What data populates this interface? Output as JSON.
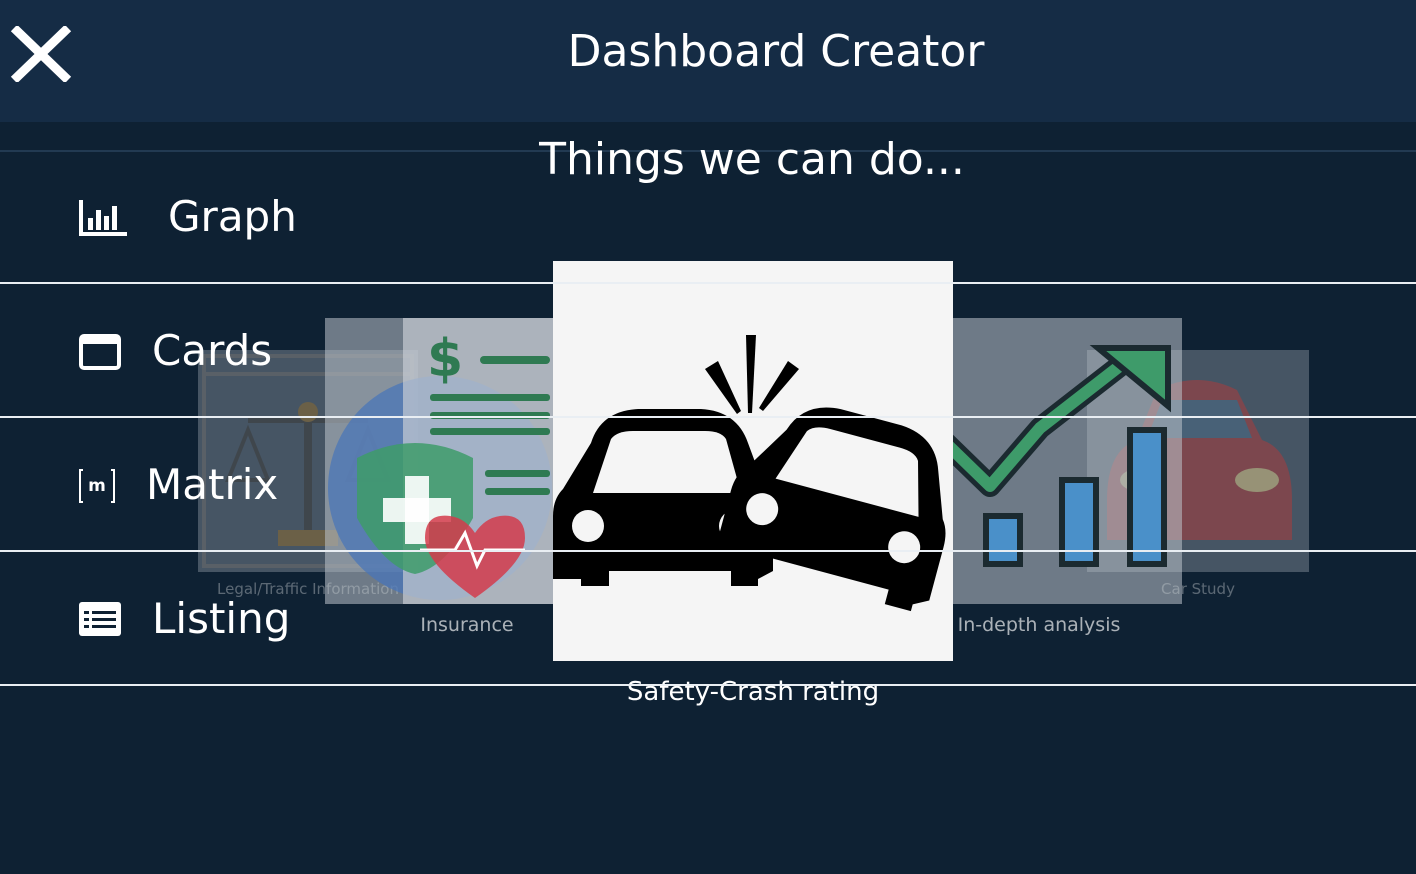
{
  "header": {
    "title": "Dashboard Creator",
    "close_icon": "close-icon"
  },
  "carousel": {
    "title": "Things we can do...",
    "cards": [
      {
        "caption": "Legal/Traffic Information",
        "icon": "scales-of-justice-icon"
      },
      {
        "caption": "Insurance",
        "icon": "health-insurance-document-icon"
      },
      {
        "caption": "Safety-Crash rating",
        "icon": "car-crash-icon"
      },
      {
        "caption": "In-depth analysis",
        "icon": "growth-chart-icon"
      },
      {
        "caption": "Car Study",
        "icon": "red-car-icon"
      }
    ]
  },
  "menu": {
    "items": [
      {
        "label": "Graph",
        "icon": "bar-chart-icon"
      },
      {
        "label": "Cards",
        "icon": "card-window-icon"
      },
      {
        "label": "Matrix",
        "icon": "matrix-icon"
      },
      {
        "label": "Listing",
        "icon": "list-icon"
      }
    ]
  },
  "colors": {
    "background": "#0e2133",
    "header": "#152c45",
    "accent_green": "#3e9b6a",
    "accent_blue": "#4a90c9"
  }
}
